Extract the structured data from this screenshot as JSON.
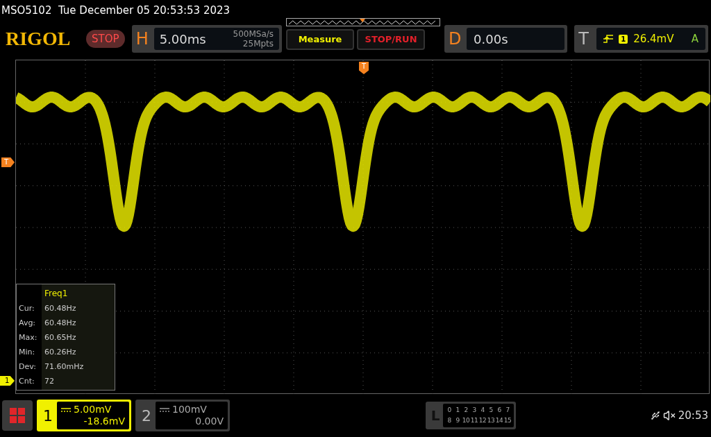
{
  "status_line": "MSO5102  Tue December 05 20:53:53 2023",
  "toolbar": {
    "logo": "RIGOL",
    "run_state": "STOP",
    "horizontal": {
      "label": "H",
      "scale": "5.00ms",
      "sample_rate": "500MSa/s",
      "memory_depth": "25Mpts"
    },
    "buttons": [
      "Measure",
      "STOP/RUN"
    ],
    "delay": {
      "label": "D",
      "value": "0.00s"
    },
    "trigger": {
      "label": "T",
      "source": "1",
      "level": "26.4mV",
      "mode": "A"
    }
  },
  "screen": {
    "top_trigger_marker": "T",
    "trigger_level_marker": "T",
    "channel_marker": "1",
    "measurement": {
      "title": "Freq1",
      "rows": [
        {
          "label": "Cur:",
          "value": "60.48Hz"
        },
        {
          "label": "Avg:",
          "value": "60.48Hz"
        },
        {
          "label": "Max:",
          "value": "60.65Hz"
        },
        {
          "label": "Min:",
          "value": "60.26Hz"
        },
        {
          "label": "Dev:",
          "value": "71.60mHz"
        },
        {
          "label": "Cnt:",
          "value": "72"
        }
      ]
    }
  },
  "channels": [
    {
      "number": "1",
      "scale": "5.00mV",
      "offset": "-18.6mV",
      "on": true
    },
    {
      "number": "2",
      "scale": "100mV",
      "offset": "0.00V",
      "on": false
    }
  ],
  "logic": {
    "label": "L",
    "rows": [
      [
        "0",
        "1",
        "2",
        "3",
        "4",
        "5",
        "6",
        "7"
      ],
      [
        "8",
        "9",
        "10",
        "11",
        "12",
        "13",
        "14",
        "15"
      ]
    ]
  },
  "clock": "20:53"
}
